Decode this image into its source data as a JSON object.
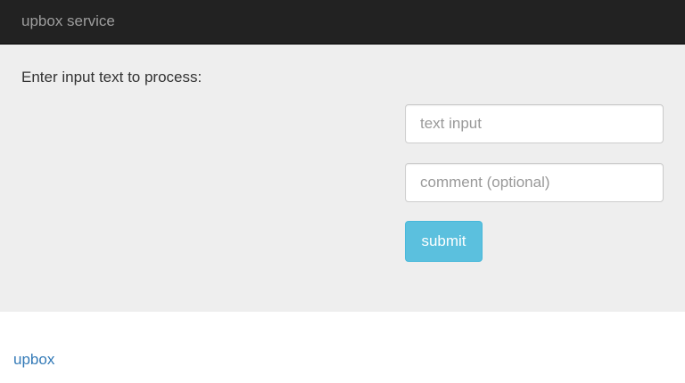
{
  "navbar": {
    "brand": "upbox service"
  },
  "form": {
    "prompt": "Enter input text to process:",
    "text_input": {
      "placeholder": "text input",
      "value": ""
    },
    "comment_input": {
      "placeholder": "comment (optional)",
      "value": ""
    },
    "submit_label": "submit"
  },
  "footer": {
    "link": "upbox"
  },
  "colors": {
    "navbar_bg": "#222222",
    "brand_text": "#9d9d9d",
    "panel_bg": "#eeeeee",
    "button_bg": "#5bc0de",
    "link": "#337ab7"
  }
}
